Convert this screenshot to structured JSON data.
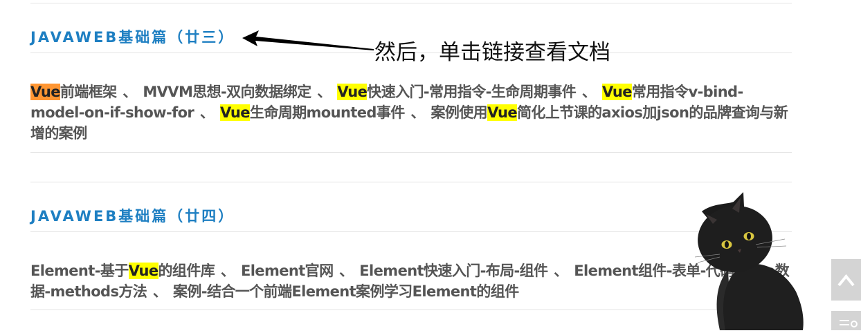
{
  "posts": [
    {
      "title": "JAVAWEB基础篇（廿三）",
      "links": [
        {
          "parts": [
            {
              "text": "Vue",
              "hl": "orange"
            },
            {
              "text": "前端框架"
            }
          ]
        },
        {
          "parts": [
            {
              "text": "MVVM思想-双向数据绑定"
            }
          ]
        },
        {
          "parts": [
            {
              "text": "Vue",
              "hl": "yellow"
            },
            {
              "text": "快速入门-常用指令-生命周期事件"
            }
          ]
        },
        {
          "parts": [
            {
              "text": "Vue",
              "hl": "yellow"
            },
            {
              "text": "常用指令v-bind-model-on-if-show-for"
            }
          ]
        },
        {
          "parts": [
            {
              "text": "Vue",
              "hl": "yellow"
            },
            {
              "text": "生命周期mounted事件"
            }
          ]
        },
        {
          "parts": [
            {
              "text": "案例使用"
            },
            {
              "text": "Vue",
              "hl": "yellow"
            },
            {
              "text": "简化上节课的axios加json的品牌查询与新增的案例"
            }
          ]
        }
      ]
    },
    {
      "title": "JAVAWEB基础篇（廿四）",
      "links": [
        {
          "parts": [
            {
              "text": "Element-基于"
            },
            {
              "text": "Vue",
              "hl": "yellow"
            },
            {
              "text": "的组件库"
            }
          ]
        },
        {
          "parts": [
            {
              "text": "Element官网"
            }
          ]
        },
        {
          "parts": [
            {
              "text": "Element快速入门-布局-组件"
            }
          ]
        },
        {
          "parts": [
            {
              "text": "Element组件-表单-代码-data数据-methods方法"
            }
          ]
        },
        {
          "parts": [
            {
              "text": "案例-结合一个前端Element案例学习Element的组件"
            }
          ]
        }
      ]
    }
  ],
  "separator": " 、 ",
  "annotation": "然后，单击链接查看文档",
  "colors": {
    "title": "#1e7fc2",
    "body_text": "#555555",
    "highlight_yellow": "#ffff00",
    "highlight_orange": "#ff9632",
    "divider": "#e3e3e3",
    "side_button": "#d4d4d4"
  },
  "icons": {
    "annotation_arrow": "arrow-left-icon",
    "mascot": "black-cat-mascot",
    "scroll_top": "chevron-up-icon",
    "menu": "menu-icon"
  }
}
